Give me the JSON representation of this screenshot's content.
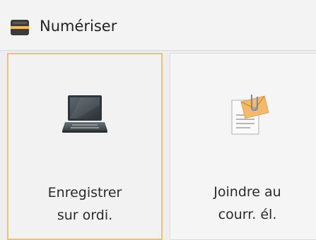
{
  "header": {
    "title": "Numériser",
    "icon": "scanner-icon"
  },
  "tiles": [
    {
      "icon": "laptop-icon",
      "label_line1": "Enregistrer",
      "label_line2": "sur ordi.",
      "selected": true
    },
    {
      "icon": "email-attachment-icon",
      "label_line1": "Joindre au",
      "label_line2": "courr. él.",
      "selected": false
    }
  ],
  "colors": {
    "selection_border": "#f1c16b",
    "header_bg": "#f3f3f3",
    "tile_bg": "#f2f2f2"
  }
}
